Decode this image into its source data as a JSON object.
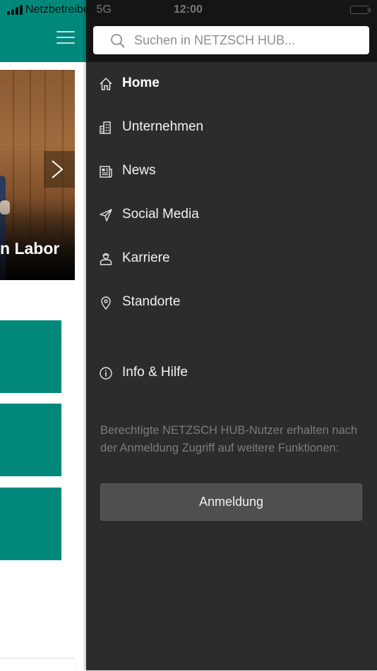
{
  "status_bar": {
    "carrier": "Netzbetreiber",
    "network": "5G",
    "time": "12:00"
  },
  "background_page": {
    "hero_caption": "n Labor",
    "tiles": [
      "",
      "",
      ""
    ]
  },
  "drawer": {
    "search_placeholder": "Suchen in NETZSCH HUB...",
    "menu": [
      {
        "label": "Home",
        "icon": "home-icon",
        "active": true
      },
      {
        "label": "Unternehmen",
        "icon": "building-icon"
      },
      {
        "label": "News",
        "icon": "newspaper-icon"
      },
      {
        "label": "Social Media",
        "icon": "paper-plane-icon"
      },
      {
        "label": "Karriere",
        "icon": "person-icon"
      },
      {
        "label": "Standorte",
        "icon": "location-pin-icon"
      }
    ],
    "info_item": {
      "label": "Info & Hilfe",
      "icon": "info-icon"
    },
    "login_hint": "Berechtigte NETZSCH HUB-Nutzer erhalten nach der Anmeldung Zugriff auf weitere Funktionen:",
    "login_button": "Anmeldung"
  },
  "colors": {
    "teal": "#00897b",
    "drawer_bg": "#2c2c2c",
    "drawer_header": "#151515",
    "button_bg": "#4f4f4f"
  }
}
